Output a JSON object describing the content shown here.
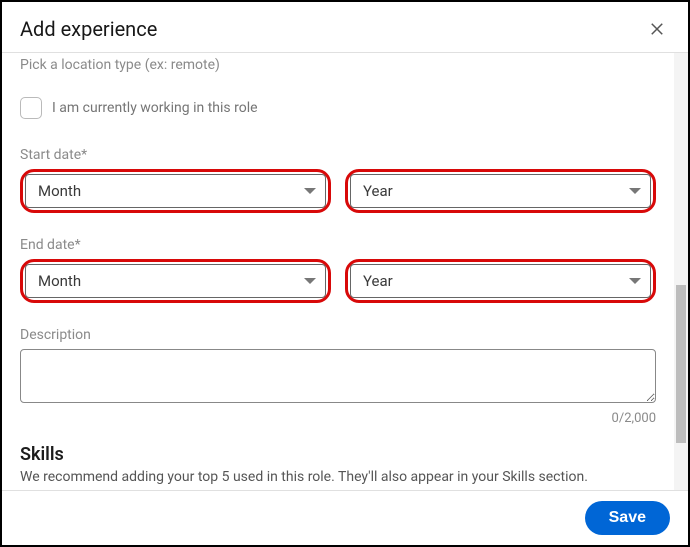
{
  "header": {
    "title": "Add experience"
  },
  "location": {
    "placeholder": "Pick a location type (ex: remote)"
  },
  "currentRole": {
    "label": "I am currently working in this role"
  },
  "startDate": {
    "label": "Start date*",
    "monthPlaceholder": "Month",
    "yearPlaceholder": "Year"
  },
  "endDate": {
    "label": "End date*",
    "monthPlaceholder": "Month",
    "yearPlaceholder": "Year"
  },
  "description": {
    "label": "Description",
    "value": "",
    "counter": "0/2,000"
  },
  "skills": {
    "title": "Skills",
    "subtitle": "We recommend adding your top 5 used in this role. They'll also appear in your Skills section."
  },
  "footer": {
    "saveLabel": "Save"
  }
}
